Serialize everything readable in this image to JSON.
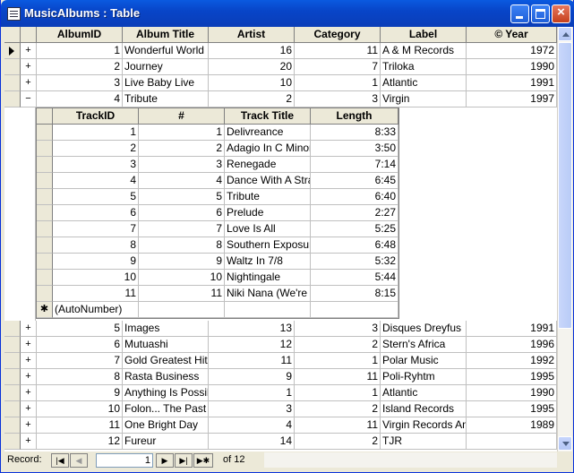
{
  "window": {
    "title": "MusicAlbums : Table"
  },
  "table": {
    "columns": [
      "AlbumID",
      "Album Title",
      "Artist",
      "Category",
      "Label",
      "© Year"
    ],
    "rows_top": [
      {
        "expander": "+",
        "id": "1",
        "title": "Wonderful World",
        "artist": "16",
        "category": "11",
        "label": "A & M Records",
        "year": "1972"
      },
      {
        "expander": "+",
        "id": "2",
        "title": "Journey",
        "artist": "20",
        "category": "7",
        "label": "Triloka",
        "year": "1990"
      },
      {
        "expander": "+",
        "id": "3",
        "title": "Live Baby Live",
        "artist": "10",
        "category": "1",
        "label": "Atlantic",
        "year": "1991"
      },
      {
        "expander": "−",
        "id": "4",
        "title": "Tribute",
        "artist": "2",
        "category": "3",
        "label": "Virgin",
        "year": "1997"
      }
    ],
    "rows_bottom": [
      {
        "expander": "+",
        "id": "5",
        "title": "Images",
        "artist": "13",
        "category": "3",
        "label": "Disques Dreyfus",
        "year": "1991"
      },
      {
        "expander": "+",
        "id": "6",
        "title": "Mutuashi",
        "artist": "12",
        "category": "2",
        "label": "Stern's Africa",
        "year": "1996"
      },
      {
        "expander": "+",
        "id": "7",
        "title": "Gold Greatest Hits",
        "artist": "11",
        "category": "1",
        "label": "Polar Music",
        "year": "1992"
      },
      {
        "expander": "+",
        "id": "8",
        "title": "Rasta Business",
        "artist": "9",
        "category": "11",
        "label": "Poli-Ryhtm",
        "year": "1995"
      },
      {
        "expander": "+",
        "id": "9",
        "title": "Anything Is Possible",
        "artist": "1",
        "category": "1",
        "label": "Atlantic",
        "year": "1990"
      },
      {
        "expander": "+",
        "id": "10",
        "title": "Folon... The Past",
        "artist": "3",
        "category": "2",
        "label": "Island Records",
        "year": "1995"
      },
      {
        "expander": "+",
        "id": "11",
        "title": "One Bright Day",
        "artist": "4",
        "category": "11",
        "label": "Virgin Records America",
        "year": "1989"
      },
      {
        "expander": "+",
        "id": "12",
        "title": "Fureur",
        "artist": "14",
        "category": "2",
        "label": "TJR",
        "year": ""
      }
    ]
  },
  "subtable": {
    "columns": [
      "TrackID",
      "#",
      "Track Title",
      "Length"
    ],
    "rows": [
      {
        "id": "1",
        "num": "1",
        "title": "Delivreance",
        "length": "8:33"
      },
      {
        "id": "2",
        "num": "2",
        "title": "Adagio In C Minor",
        "length": "3:50"
      },
      {
        "id": "3",
        "num": "3",
        "title": "Renegade",
        "length": "7:14"
      },
      {
        "id": "4",
        "num": "4",
        "title": "Dance With A Stranger",
        "length": "6:45"
      },
      {
        "id": "5",
        "num": "5",
        "title": "Tribute",
        "length": "6:40"
      },
      {
        "id": "6",
        "num": "6",
        "title": "Prelude",
        "length": "2:27"
      },
      {
        "id": "7",
        "num": "7",
        "title": "Love Is All",
        "length": "5:25"
      },
      {
        "id": "8",
        "num": "8",
        "title": "Southern Exposure",
        "length": "6:48"
      },
      {
        "id": "9",
        "num": "9",
        "title": "Waltz In 7/8",
        "length": "5:32"
      },
      {
        "id": "10",
        "num": "10",
        "title": "Nightingale",
        "length": "5:44"
      },
      {
        "id": "11",
        "num": "11",
        "title": "Niki Nana (We're One)",
        "length": "8:15"
      }
    ],
    "new_row": {
      "marker": "✱",
      "id": "(AutoNumber)"
    }
  },
  "navigation": {
    "label": "Record:",
    "current": "1",
    "of_text": "of  12"
  }
}
